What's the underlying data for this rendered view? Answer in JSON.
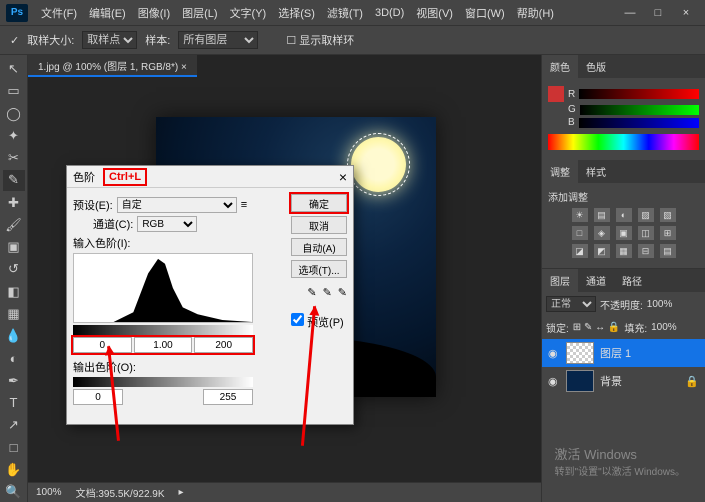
{
  "menu": {
    "file": "文件(F)",
    "edit": "编辑(E)",
    "image": "图像(I)",
    "layer": "图层(L)",
    "type": "文字(Y)",
    "select": "选择(S)",
    "filter": "滤镜(T)",
    "3d": "3D(D)",
    "view": "视图(V)",
    "window": "窗口(W)",
    "help": "帮助(H)"
  },
  "optbar": {
    "sampleSize": "取样大小:",
    "sampleSizeVal": "取样点",
    "sample": "样本:",
    "sampleVal": "所有图层",
    "show": "显示取样环"
  },
  "docTab": "1.jpg @ 100% (图层 1, RGB/8*) ×",
  "dialog": {
    "title": "色阶",
    "shortcut": "Ctrl+L",
    "preset": "预设(E):",
    "presetVal": "自定",
    "channel": "通道(C):",
    "channelVal": "RGB",
    "inputLevels": "输入色阶(I):",
    "inBlack": "0",
    "inGamma": "1.00",
    "inWhite": "200",
    "outputLevels": "输出色阶(O):",
    "outBlack": "0",
    "outWhite": "255",
    "ok": "确定",
    "cancel": "取消",
    "auto": "自动(A)",
    "options": "选项(T)...",
    "preview": "预览(P)"
  },
  "panels": {
    "colorTab": "颜色",
    "swatchTab": "色版",
    "adjTab": "调整",
    "styleTab": "样式",
    "addAdj": "添加调整",
    "layerTab": "图层",
    "channelsTab": "通道",
    "pathsTab": "路径",
    "blendMode": "正常",
    "opacityLabel": "不透明度:",
    "opacity": "100%",
    "lockLabel": "锁定:",
    "fillLabel": "填充:",
    "fill": "100%",
    "layer1": "图层 1",
    "bgLayer": "背景"
  },
  "status": {
    "zoom": "100%",
    "doc": "文档:395.5K/922.9K"
  },
  "watermark": {
    "l1": "激活 Windows",
    "l2": "转到\"设置\"以激活 Windows。"
  }
}
